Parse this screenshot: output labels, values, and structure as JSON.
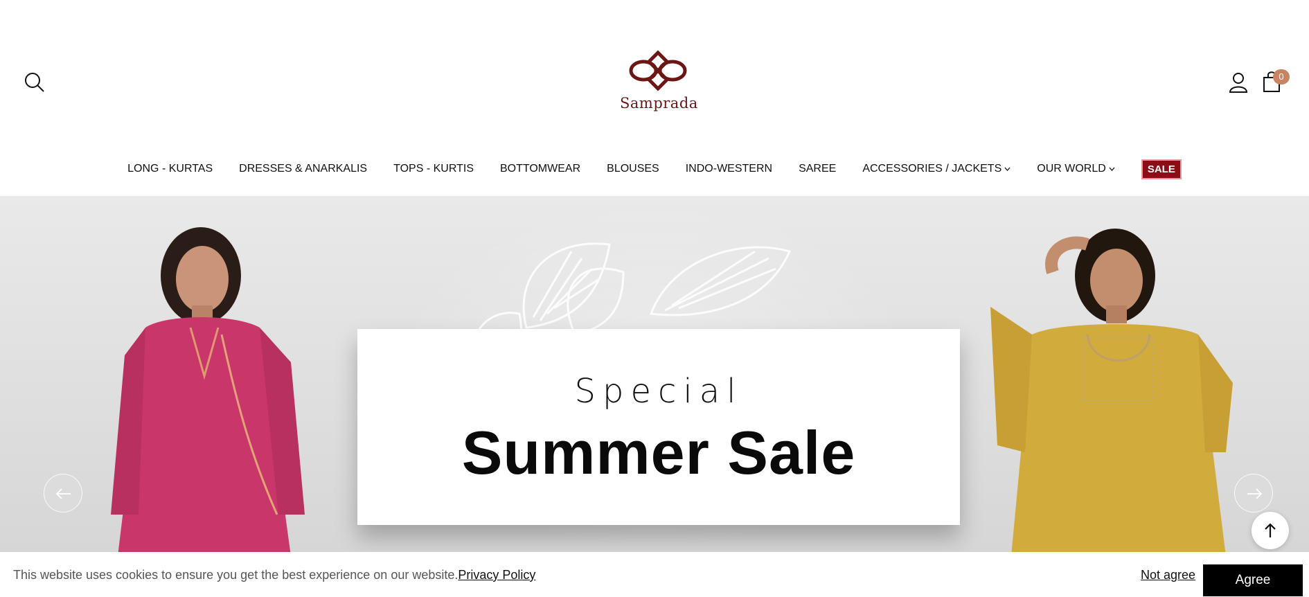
{
  "brand": {
    "name": "Samprada",
    "accent": "#6b1515"
  },
  "header": {
    "search_icon": "search-icon",
    "account_icon": "user-icon",
    "cart_icon": "shopping-bag-icon",
    "cart_count": "0"
  },
  "nav": {
    "items": [
      {
        "label": "LONG - KURTAS"
      },
      {
        "label": "DRESSES & ANARKALIS"
      },
      {
        "label": "TOPS - KURTIS"
      },
      {
        "label": "BOTTOMWEAR"
      },
      {
        "label": "BLOUSES"
      },
      {
        "label": "INDO-WESTERN"
      },
      {
        "label": "SAREE"
      },
      {
        "label": "ACCESSORIES / JACKETS",
        "dropdown": true
      },
      {
        "label": "OUR WORLD",
        "dropdown": true
      }
    ],
    "sale": {
      "label": "SALE",
      "color": "#8d0d17"
    }
  },
  "hero": {
    "kicker": "Special",
    "title": "Summer Sale",
    "prev_icon": "arrow-left-icon",
    "next_icon": "arrow-right-icon",
    "back_to_top_icon": "arrow-up-icon"
  },
  "cookie": {
    "message": "This website uses cookies to ensure you get the best experience on our website.",
    "policy_link": "Privacy Policy",
    "not_agree": "Not agree",
    "agree": "Agree"
  }
}
